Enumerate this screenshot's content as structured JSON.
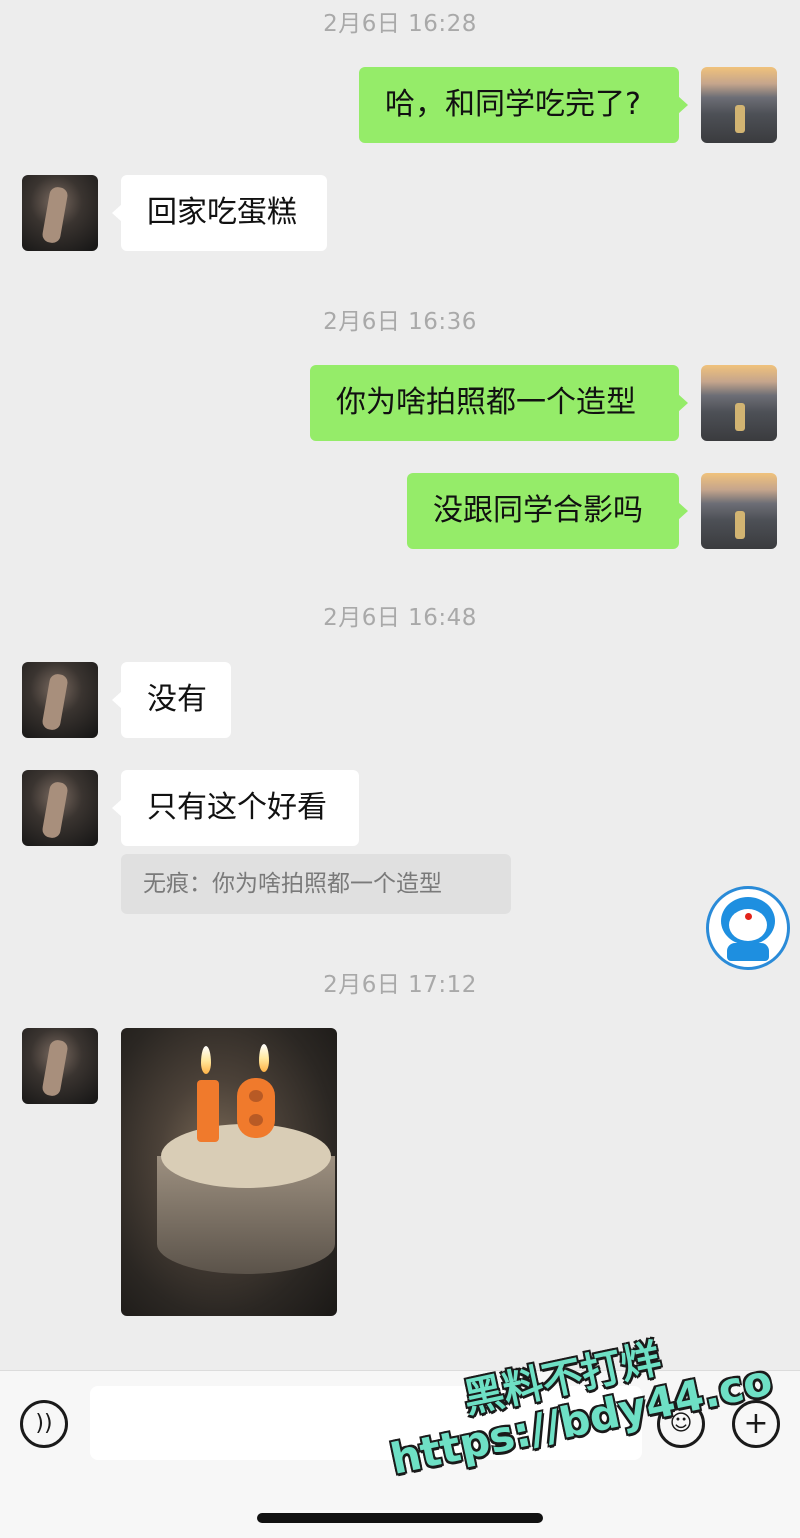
{
  "messages": {
    "time_1": "2月6日 16:28",
    "msg_1": "哈，和同学吃完了?",
    "msg_2": "回家吃蛋糕",
    "time_2": "2月6日 16:36",
    "msg_3": "你为啥拍照都一个造型",
    "msg_4": "没跟同学合影吗",
    "time_3": "2月6日 16:48",
    "msg_5": "没有",
    "msg_6": "只有这个好看",
    "quote": "无痕：你为啥拍照都一个造型",
    "time_4": "2月6日 17:12"
  },
  "icons": {
    "voice": "voice-icon",
    "emoji": "emoji-icon",
    "plus": "plus-icon",
    "float": "doraemon-icon"
  },
  "colors": {
    "background": "#ededed",
    "outgoing_bubble": "#95ec69",
    "incoming_bubble": "#ffffff",
    "watermark": "#6ee0c5"
  },
  "watermark": {
    "line1": "黑料不打烊",
    "line2": "https://bdy44.co"
  }
}
